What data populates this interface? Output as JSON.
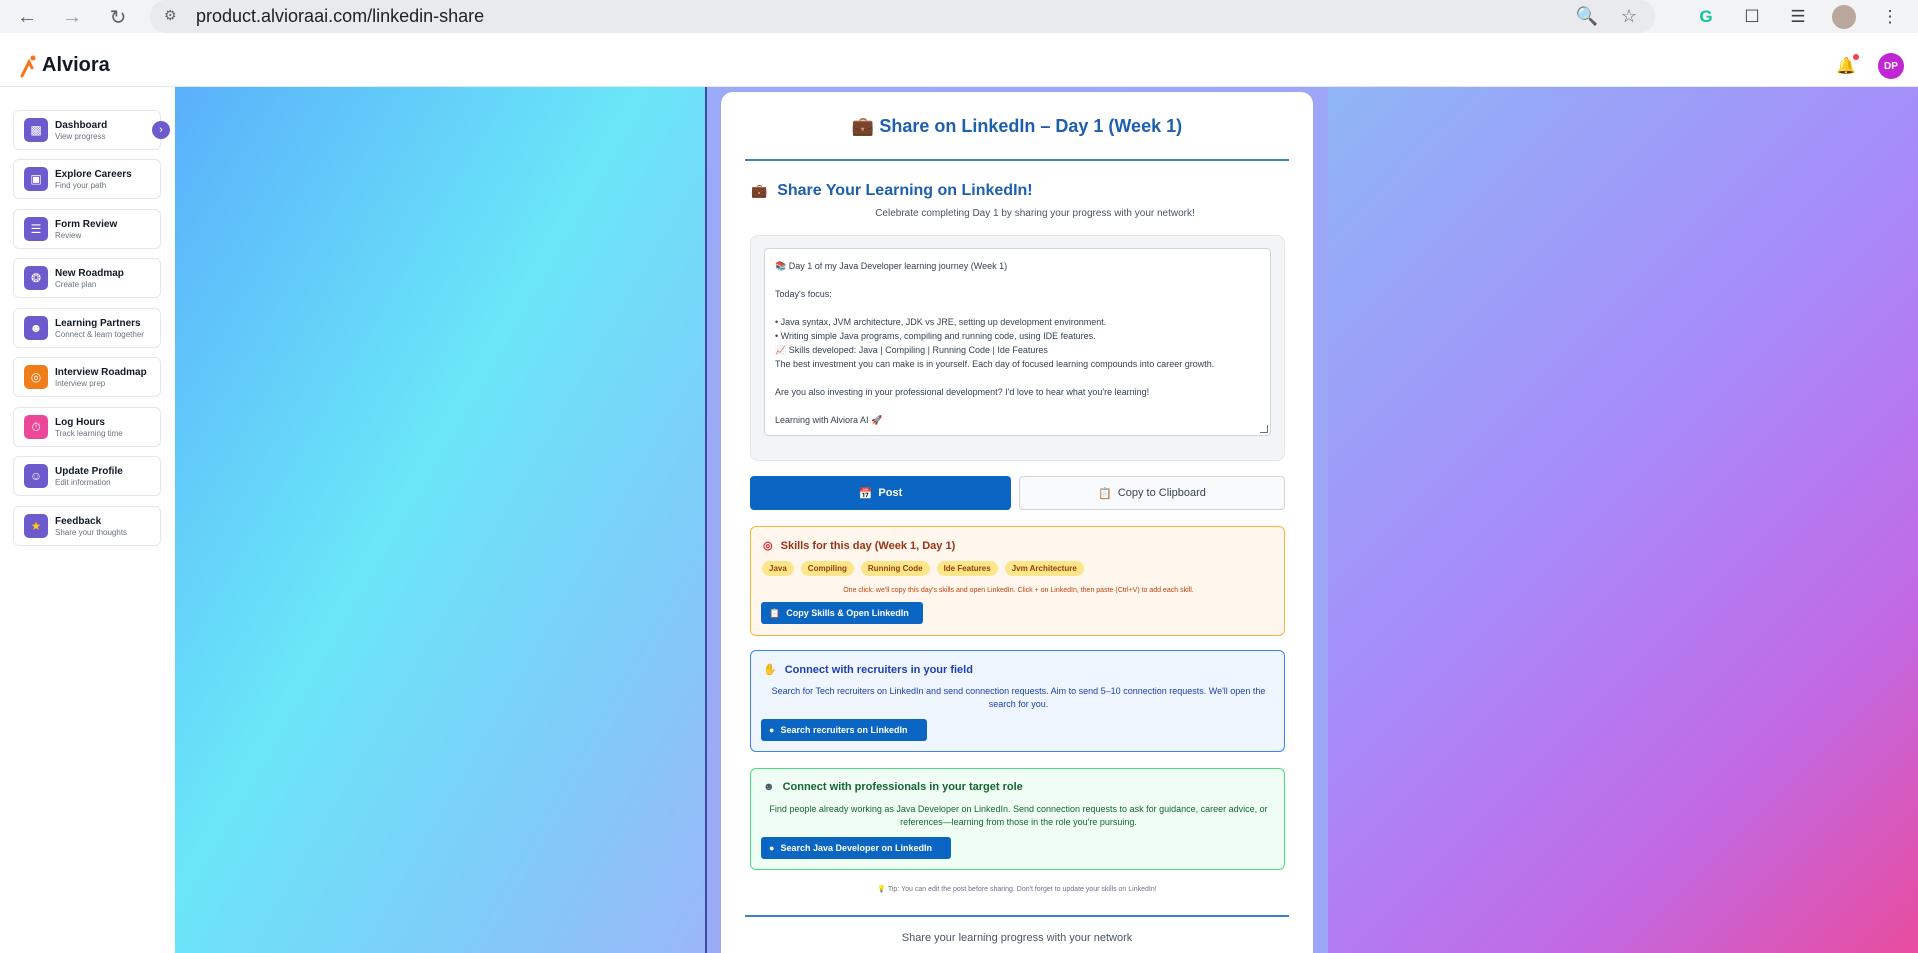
{
  "browser": {
    "url": "product.alvioraai.com/linkedin-share"
  },
  "app": {
    "brand": "Alviora",
    "avatar_initials": "DP"
  },
  "sidebar": {
    "items": [
      {
        "title": "Dashboard",
        "subtitle": "View progress",
        "icon": "chart-icon",
        "color": "#6d5acd"
      },
      {
        "title": "Explore Careers",
        "subtitle": "Find your path",
        "icon": "briefcase-icon",
        "color": "#6d5acd"
      },
      {
        "title": "Form Review",
        "subtitle": "Review",
        "icon": "document-icon",
        "color": "#6d5acd"
      },
      {
        "title": "New Roadmap",
        "subtitle": "Create plan",
        "icon": "compass-icon",
        "color": "#6d5acd"
      },
      {
        "title": "Learning Partners",
        "subtitle": "Connect & learn together",
        "icon": "people-icon",
        "color": "#6d5acd"
      },
      {
        "title": "Interview Roadmap",
        "subtitle": "Interview prep",
        "icon": "target-icon",
        "color": "#ef7d1a"
      },
      {
        "title": "Log Hours",
        "subtitle": "Track learning time",
        "icon": "stopwatch-icon",
        "color": "#ec4899"
      },
      {
        "title": "Update Profile",
        "subtitle": "Edit information",
        "icon": "user-icon",
        "color": "#6d5acd"
      },
      {
        "title": "Feedback",
        "subtitle": "Share your thoughts",
        "icon": "star-icon",
        "color": "#6d5acd"
      }
    ]
  },
  "card": {
    "title": "Share on LinkedIn – Day 1 (Week 1)",
    "heading": "Share Your Learning on LinkedIn!",
    "subheading": "Celebrate completing Day 1 by sharing your progress with your network!",
    "post_lines": [
      "📚 Day 1 of my Java Developer learning journey (Week 1)",
      "",
      "Today's focus:",
      "",
      "• Java syntax, JVM architecture, JDK vs JRE, setting up development environment.",
      "• Writing simple Java programs, compiling and running code, using IDE features.",
      "📈 Skills developed: Java | Compiling | Running Code | Ide Features",
      "The best investment you can make is in yourself. Each day of focused learning compounds into career growth.",
      "",
      "Are you also investing in your professional development? I'd love to hear what you're learning!",
      "",
      "Learning with Alviora AI 🚀"
    ],
    "post_button": "Post",
    "copy_button": "Copy to Clipboard",
    "skills": {
      "heading": "Skills for this day (Week 1, Day 1)",
      "chips": [
        "Java",
        "Compiling",
        "Running Code",
        "Ide Features",
        "Jvm Architecture"
      ],
      "note": "One click: we'll copy this day's skills and open LinkedIn. Click + on LinkedIn, then paste (Ctrl+V) to add each skill.",
      "button": "Copy Skills & Open LinkedIn"
    },
    "recruiters": {
      "heading": "Connect with recruiters in your field",
      "description": "Search for Tech recruiters on LinkedIn and send connection requests. Aim to send 5–10 connection requests. We'll open the search for you.",
      "button": "Search recruiters on LinkedIn"
    },
    "professionals": {
      "heading": "Connect with professionals in your target role",
      "description": "Find people already working as Java Developer on LinkedIn. Send connection requests to ask for guidance, career advice, or references—learning from those in the role you're pursuing.",
      "button": "Search Java Developer on LinkedIn"
    },
    "tip": "Tip: You can edit the post before sharing. Don't forget to update your skills on LinkedIn!",
    "footer": "Share your learning progress with your network"
  }
}
